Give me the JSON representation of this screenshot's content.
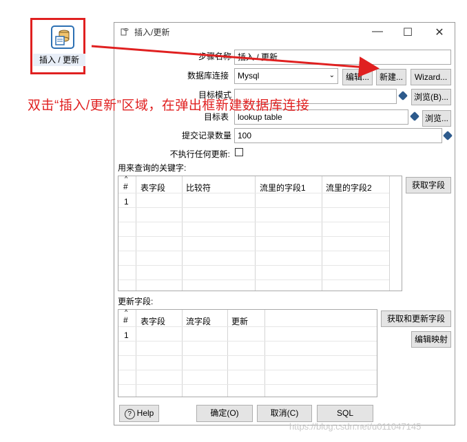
{
  "step": {
    "label": "插入 / 更新"
  },
  "dialog": {
    "title": "插入/更新",
    "window_controls": {
      "minimize": "—",
      "maximize": "☐",
      "close": "✕"
    },
    "fields": {
      "step_name_label": "步骤名称",
      "step_name_value": "插入 / 更新",
      "db_conn_label": "数据库连接",
      "db_conn_value": "Mysql",
      "edit_btn": "编辑...",
      "new_btn": "新建...",
      "wizard_btn": "Wizard...",
      "target_schema_label": "目标模式",
      "target_schema_value": "",
      "browse_schema_btn": "浏览(B)...",
      "target_table_label": "目标表",
      "target_table_value": "lookup table",
      "browse_table_btn": "浏览...",
      "commit_size_label": "提交记录数量",
      "commit_size_value": "100",
      "no_update_label": "不执行任何更新:"
    },
    "key_section": {
      "label": "用来查询的关键字:",
      "columns": [
        "#",
        "表字段",
        "比较符",
        "流里的字段1",
        "流里的字段2"
      ],
      "rows": [
        [
          "1",
          "",
          "",
          "",
          ""
        ]
      ],
      "get_fields_btn": "获取字段"
    },
    "update_section": {
      "label": "更新字段:",
      "columns": [
        "#",
        "表字段",
        "流字段",
        "更新"
      ],
      "rows": [
        [
          "1",
          "",
          "",
          ""
        ]
      ],
      "get_update_fields_btn": "获取和更新字段",
      "edit_mapping_btn": "编辑映射"
    },
    "footer": {
      "help_btn": "Help",
      "ok_btn": "确定(O)",
      "cancel_btn": "取消(C)",
      "sql_btn": "SQL"
    }
  },
  "annotation": {
    "text": "双击“插入/更新”区域，在弹出框新建数据库连接",
    "color": "#e02020"
  },
  "watermark": "https://blog.csdn.net/u011047145"
}
